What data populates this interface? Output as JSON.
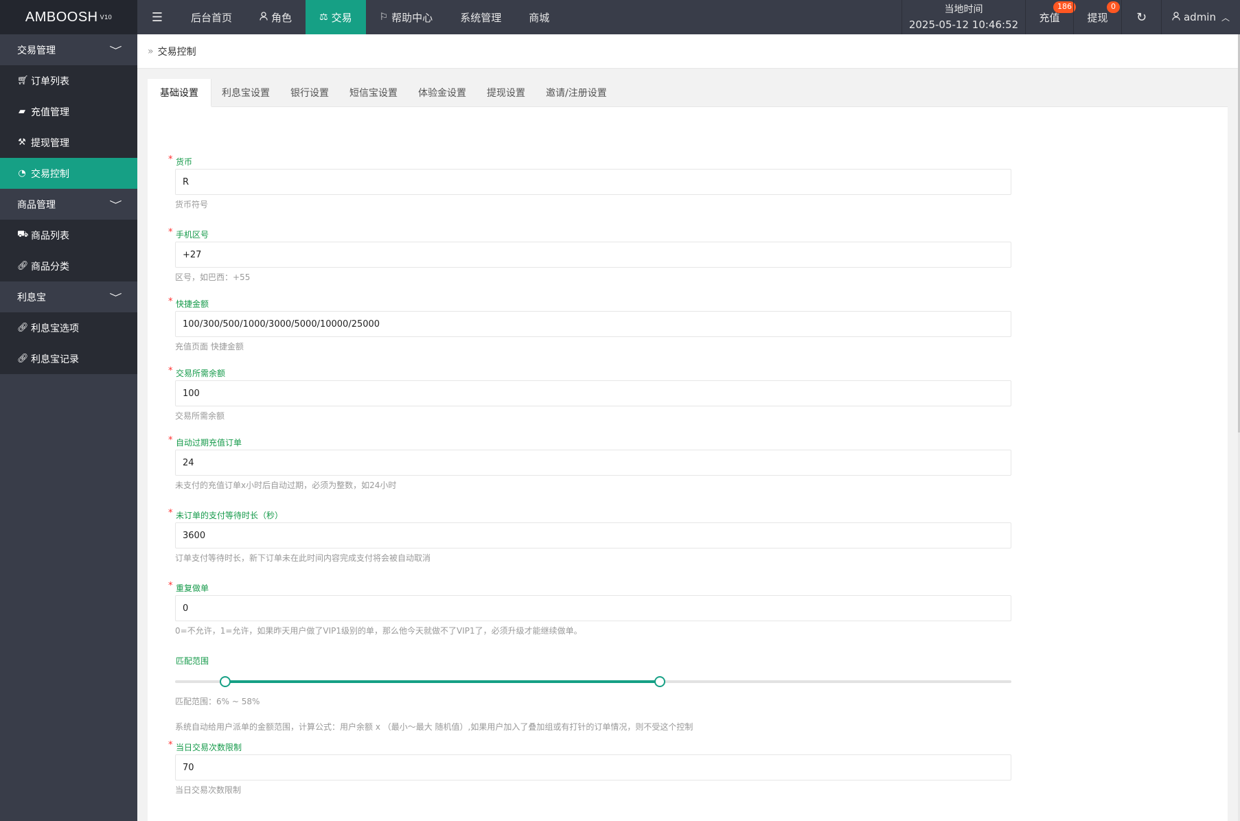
{
  "app": {
    "logo": "AMBOOSH",
    "version": "V10"
  },
  "nav": [
    {
      "label": "后台首页",
      "icon": ""
    },
    {
      "label": "角色",
      "icon": "user-icon"
    },
    {
      "label": "交易",
      "icon": "scale-icon",
      "active": true
    },
    {
      "label": "帮助中心",
      "icon": "flag-icon"
    },
    {
      "label": "系统管理",
      "icon": ""
    },
    {
      "label": "商城",
      "icon": ""
    }
  ],
  "header": {
    "time_label": "当地时间",
    "time_value": "2025-05-12 10:46:52",
    "recharge_label": "充值",
    "recharge_badge": "186",
    "withdraw_label": "提现",
    "withdraw_badge": "0",
    "user_label": "admin"
  },
  "sidebar": {
    "group1": "交易管理",
    "items1": [
      "订单列表",
      "充值管理",
      "提现管理",
      "交易控制"
    ],
    "group2": "商品管理",
    "items2": [
      "商品列表",
      "商品分类"
    ],
    "group3": "利息宝",
    "items3": [
      "利息宝选项",
      "利息宝记录"
    ]
  },
  "breadcrumb": "交易控制",
  "tabs": [
    "基础设置",
    "利息宝设置",
    "银行设置",
    "短信宝设置",
    "体验金设置",
    "提现设置",
    "邀请/注册设置"
  ],
  "form": {
    "currency": {
      "label": "货币",
      "value": "R",
      "hint": "货币符号"
    },
    "phone_code": {
      "label": "手机区号",
      "value": "+27",
      "hint": "区号，如巴西：+55"
    },
    "quick_amount": {
      "label": "快捷金额",
      "value": "100/300/500/1000/3000/5000/10000/25000",
      "hint": "充值页面 快捷金额"
    },
    "min_balance": {
      "label": "交易所需余额",
      "value": "100",
      "hint": "交易所需余额"
    },
    "auto_expire": {
      "label": "自动过期充值订单",
      "value": "24",
      "hint": "未支付的充值订单x小时后自动过期，必须为整数，如24小时"
    },
    "pay_wait": {
      "label": "未订单的支付等待时长（秒）",
      "value": "3600",
      "hint": "订单支付等待时长，新下订单未在此时间内容完成支付将会被自动取消"
    },
    "repeat": {
      "label": "重复做单",
      "value": "0",
      "hint": "0=不允许，1=允许，如果昨天用户做了VIP1级别的单，那么他今天就做不了VIP1了，必须升级才能继续做单。"
    },
    "match_range": {
      "label": "匹配范围",
      "min": 6,
      "max": 58,
      "range_text": "匹配范围：6% ~ 58%",
      "hint": "系统自动给用户派单的金额范围，计算公式：用户余额 x （最小～最大 随机值）,如果用户加入了叠加组或有打针的订单情况，则不受这个控制"
    },
    "daily_limit": {
      "label": "当日交易次数限制",
      "value": "70",
      "hint": "当日交易次数限制"
    }
  }
}
